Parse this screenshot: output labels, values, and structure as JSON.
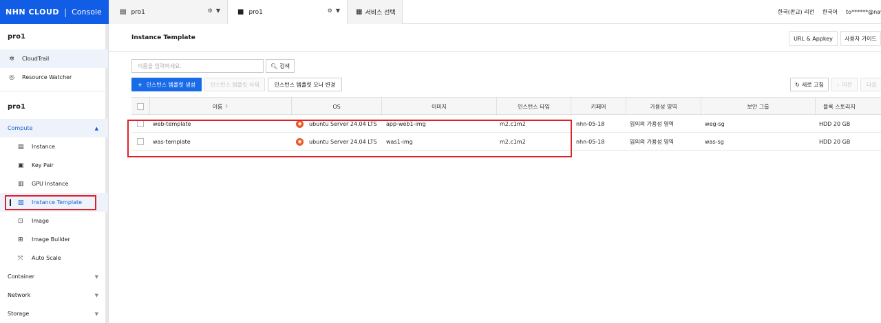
{
  "brand": {
    "logo": "NHN CLOUD",
    "sub": "Console"
  },
  "top_tabs": [
    {
      "icon": "document-icon",
      "label": "pro1"
    },
    {
      "icon": "folder-icon",
      "label": "pro1"
    },
    {
      "icon": "grid-icon",
      "label": "서비스 선택"
    }
  ],
  "top_right": {
    "region": "한국(판교) 리전",
    "language": "한국어",
    "user": "to******@naver"
  },
  "sidebar": {
    "org_title": "pro1",
    "org_items": [
      {
        "icon": "cloudtrail-icon",
        "label": "CloudTrail"
      },
      {
        "icon": "resource-watcher-icon",
        "label": "Resource Watcher"
      }
    ],
    "project_title": "pro1",
    "categories": [
      {
        "label": "Compute",
        "open": true
      },
      {
        "label": "Container",
        "open": false
      },
      {
        "label": "Network",
        "open": false
      },
      {
        "label": "Storage",
        "open": false
      }
    ],
    "compute_items": [
      {
        "icon": "instance-icon",
        "label": "Instance"
      },
      {
        "icon": "key-pair-icon",
        "label": "Key Pair"
      },
      {
        "icon": "gpu-icon",
        "label": "GPU Instance"
      },
      {
        "icon": "instance-template-icon",
        "label": "Instance Template"
      },
      {
        "icon": "image-icon",
        "label": "Image"
      },
      {
        "icon": "image-builder-icon",
        "label": "Image Builder"
      },
      {
        "icon": "auto-scale-icon",
        "label": "Auto Scale"
      }
    ]
  },
  "page": {
    "title": "Instance Template",
    "url_appkey": "URL & Appkey",
    "user_guide": "사용자 가이드"
  },
  "search": {
    "placeholder": "이름을 입력하세요.",
    "button": "검색"
  },
  "actions": {
    "create": "인스턴스 템플릿 생성",
    "delete": "인스턴스 템플릿 삭제",
    "change_owner": "인스턴스 템플릿 오너 변경",
    "refresh": "새로 고침",
    "prev": "이전",
    "next": "다음"
  },
  "table": {
    "headers": [
      "이름",
      "OS",
      "이미지",
      "인스턴스 타입",
      "키페어",
      "가용성 영역",
      "보안 그룹",
      "블록 스토리지"
    ],
    "rows": [
      {
        "name": "web-template",
        "os": "ubuntu Server 24.04 LTS",
        "image": "app-web1-img",
        "type": "m2.c1m2",
        "keypair": "nhn-05-18",
        "zone": "임의의 가용성 영역",
        "secgroup": "weg-sg",
        "storage": "HDD 20 GB"
      },
      {
        "name": "was-template",
        "os": "ubuntu Server 24.04 LTS",
        "image": "was1-img",
        "type": "m2.c1m2",
        "keypair": "nhn-05-18",
        "zone": "임의의 가용성 영역",
        "secgroup": "was-sg",
        "storage": "HDD 20 GB"
      }
    ]
  }
}
